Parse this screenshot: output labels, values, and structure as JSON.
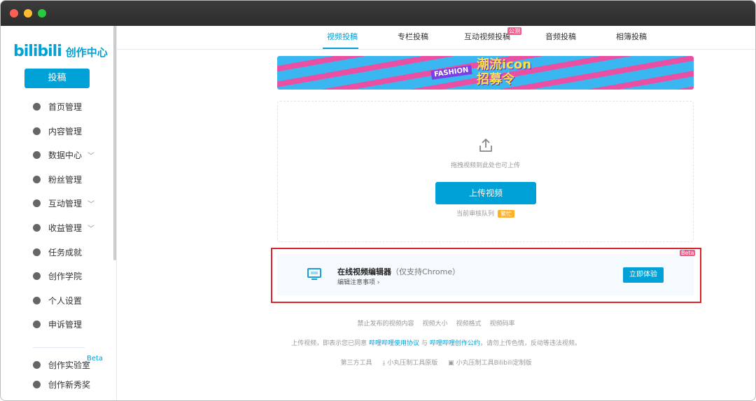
{
  "window": {
    "controls": [
      "close",
      "minimize",
      "maximize"
    ]
  },
  "sidebar": {
    "logo": "bilibili",
    "logo_suffix": "创作中心",
    "post_label": "投稿",
    "items": [
      {
        "label": "首页管理",
        "icon": "home-icon"
      },
      {
        "label": "内容管理",
        "icon": "document-icon"
      },
      {
        "label": "数据中心",
        "icon": "data-icon",
        "expand": true
      },
      {
        "label": "粉丝管理",
        "icon": "fans-icon"
      },
      {
        "label": "互动管理",
        "icon": "comment-icon",
        "expand": true
      },
      {
        "label": "收益管理",
        "icon": "income-icon",
        "expand": true
      },
      {
        "label": "任务成就",
        "icon": "medal-icon"
      },
      {
        "label": "创作学院",
        "icon": "graduation-icon"
      },
      {
        "label": "个人设置",
        "icon": "gear-icon"
      },
      {
        "label": "申诉管理",
        "icon": "shield-icon"
      },
      {
        "label": "创作实验室",
        "icon": "flask-icon",
        "badge": "Beta"
      },
      {
        "label": "创作新秀奖",
        "icon": "trophy-icon"
      }
    ]
  },
  "tabs": [
    {
      "label": "视频投稿",
      "active": true
    },
    {
      "label": "专栏投稿"
    },
    {
      "label": "互动视频投稿",
      "badge": "公测"
    },
    {
      "label": "音频投稿"
    },
    {
      "label": "相簿投稿"
    }
  ],
  "banner": {
    "title_line1": "潮流icon",
    "title_line2": "招募令",
    "tag": "FASHION"
  },
  "upload": {
    "hint": "拖拽视频到此处也可上传",
    "button": "上传视频",
    "queue_label": "当前审核队列",
    "queue_status": "繁忙"
  },
  "editor": {
    "title": "在线视频编辑器",
    "note": "（仅支持Chrome）",
    "link": "编辑注意事项 ›",
    "button": "立即体验",
    "badge": "Beta"
  },
  "footer": {
    "links": [
      "禁止发布的视频内容",
      "视频大小",
      "视频格式",
      "视频码率"
    ],
    "agreement_prefix": "上传视频，即表示您已同意",
    "agreement_link1": "哔哩哔哩使用协议",
    "agreement_and": "与",
    "agreement_link2": "哔哩哔哩创作公约",
    "agreement_suffix": "，请勿上传色情，反动等违法视频。",
    "tools_label": "第三方工具",
    "tool1": "小丸压制工具原版",
    "tool2": "小丸压制工具Bilibili定制版"
  },
  "colors": {
    "accent": "#00a1d6",
    "pink": "#f25d8e",
    "highlight": "#d9222a",
    "busy": "#ffb027"
  }
}
